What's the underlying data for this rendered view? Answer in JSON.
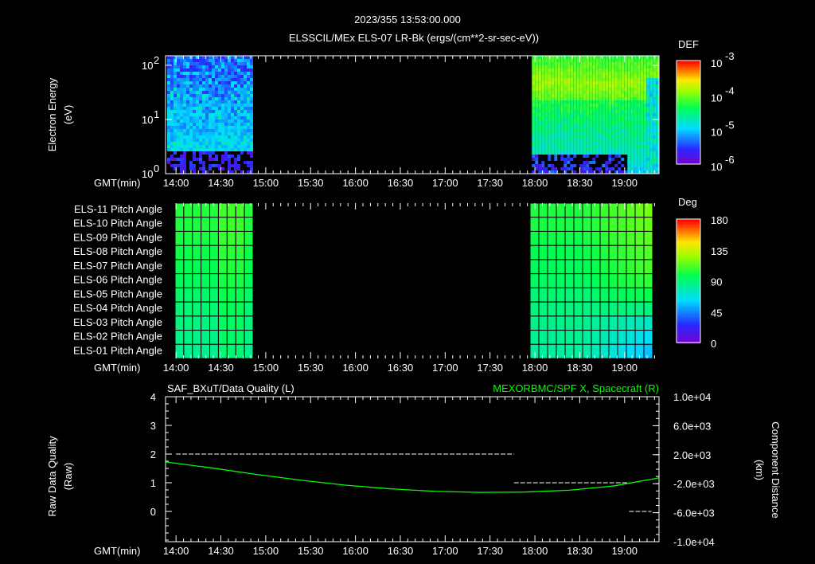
{
  "header": {
    "timestamp": "2023/355 13:53:00.000",
    "title": "ELSSCIL/MEx ELS-07 LR-Bk  (ergs/(cm**2-sr-sec-eV))"
  },
  "colors": {
    "background": "#000000",
    "axis": "#ffffff",
    "spacecraft_line": "#00ff00"
  },
  "chart_data": [
    {
      "type": "heatmap",
      "name": "energy-spectrogram",
      "ylabel_line1": "Electron Energy",
      "ylabel_line2": "(eV)",
      "xlabel": "GMT(min)",
      "x_range": [
        "13:53",
        "19:23"
      ],
      "x_ticks": [
        "14:00",
        "14:30",
        "15:00",
        "15:30",
        "16:00",
        "16:30",
        "17:00",
        "17:30",
        "18:00",
        "18:30",
        "19:00"
      ],
      "y_scale": "log",
      "y_range": [
        1,
        150
      ],
      "y_ticks": [
        {
          "base": "10",
          "exp": "0"
        },
        {
          "base": "10",
          "exp": "1"
        },
        {
          "base": "10",
          "exp": "2"
        }
      ],
      "data_intervals": [
        [
          "13:53",
          "14:51"
        ],
        [
          "17:58",
          "19:23"
        ]
      ],
      "colorbar": {
        "label": "DEF",
        "scale": "log",
        "range": [
          1e-06,
          0.001
        ],
        "ticks": [
          {
            "base": "10",
            "exp": "-3"
          },
          {
            "base": "10",
            "exp": "-4"
          },
          {
            "base": "10",
            "exp": "-5"
          },
          {
            "base": "10",
            "exp": "-6"
          }
        ]
      }
    },
    {
      "type": "heatmap",
      "name": "pitch-angle",
      "xlabel": "GMT(min)",
      "rows": [
        "ELS-11 Pitch Angle",
        "ELS-10 Pitch Angle",
        "ELS-09 Pitch Angle",
        "ELS-08 Pitch Angle",
        "ELS-07 Pitch Angle",
        "ELS-06 Pitch Angle",
        "ELS-05 Pitch Angle",
        "ELS-04 Pitch Angle",
        "ELS-03 Pitch Angle",
        "ELS-02 Pitch Angle",
        "ELS-01 Pitch Angle"
      ],
      "data_intervals": [
        [
          "14:00",
          "14:51"
        ],
        [
          "17:58",
          "19:20"
        ]
      ],
      "approx_values_deg": {
        "first_interval": [
          105,
          104,
          103,
          101,
          99,
          97,
          94,
          92,
          90,
          88,
          86
        ],
        "second_interval_start": [
          104,
          103,
          101,
          99,
          97,
          95,
          92,
          90,
          87,
          85,
          83
        ],
        "second_interval_end": [
          120,
          118,
          116,
          114,
          112,
          108,
          100,
          90,
          75,
          65,
          58
        ]
      },
      "colorbar": {
        "label": "Deg",
        "range": [
          0,
          180
        ],
        "ticks": [
          "180",
          "135",
          "90",
          "45",
          "0"
        ]
      }
    },
    {
      "type": "line",
      "name": "data-quality-and-position",
      "title_left": "SAF_BXuT/Data Quality (L)",
      "title_right": "MEXORBMC/SPF X, Spacecraft (R)",
      "ylabel_left_line1": "Raw Data Quality",
      "ylabel_left_line2": "(Raw)",
      "ylabel_right_line1": "Component Distance",
      "ylabel_right_line2": "(km)",
      "xlabel": "GMT(min)",
      "left_ylim": [
        -1,
        4
      ],
      "left_ticks": [
        "4",
        "3",
        "2",
        "1",
        "0"
      ],
      "right_ylim": [
        -10000,
        10000
      ],
      "right_ticks": [
        "1.0e+04",
        "6.0e+03",
        "2.0e+03",
        "-2.0e+03",
        "-6.0e+03",
        "-1.0e+04"
      ],
      "series": [
        {
          "name": "Data Quality",
          "color": "#ffffff",
          "style": "dashed",
          "segments": [
            {
              "start_min": 7,
              "end_min": 233,
              "value": 2
            },
            {
              "start_min": 233,
              "end_min": 310,
              "value": 1
            },
            {
              "start_min": 310,
              "end_min": 325,
              "value": 0
            }
          ]
        },
        {
          "name": "SPF X Spacecraft",
          "color": "#00ff00",
          "x_min": [
            0,
            30,
            60,
            90,
            120,
            150,
            180,
            210,
            240,
            270,
            300,
            330
          ],
          "values_km": [
            1000,
            200,
            -700,
            -1500,
            -2200,
            -2700,
            -3050,
            -3200,
            -3150,
            -2900,
            -2300,
            -1200
          ]
        }
      ]
    }
  ]
}
